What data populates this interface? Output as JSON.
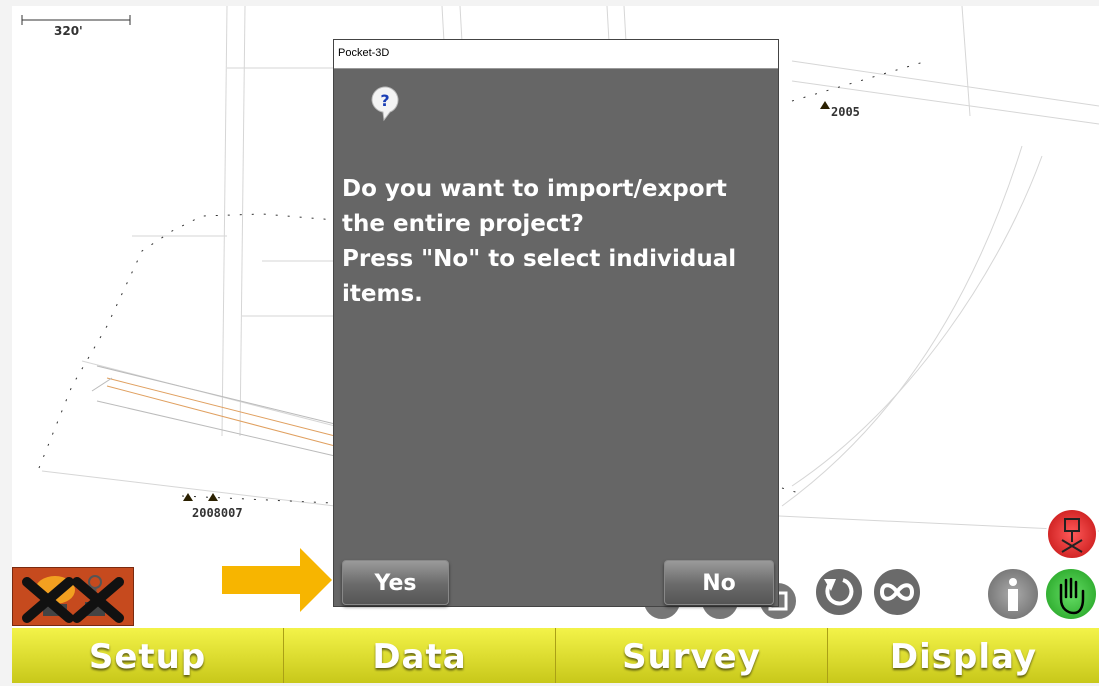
{
  "map": {
    "scale_label": "320'",
    "points": [
      {
        "label": "2005"
      },
      {
        "label": "2008007"
      }
    ]
  },
  "dialog": {
    "title": "Pocket-3D",
    "icon": "question-icon",
    "message": "Do you want to import/export the entire project?\nPress \"No\" to select individual items.",
    "yes_label": "Yes",
    "no_label": "No"
  },
  "tools": {
    "info_icon": "info-icon",
    "pan_icon": "hand-icon",
    "rotate_icon": "rotate-icon",
    "infinity_icon": "infinity-icon",
    "receiver_icon": "receiver-disconnected-icon",
    "gps_status_icon": "gps-no-fix-icon"
  },
  "tabs": [
    {
      "label": "Setup"
    },
    {
      "label": "Data"
    },
    {
      "label": "Survey"
    },
    {
      "label": "Display"
    }
  ],
  "colors": {
    "tab_yellow": "#e8e830",
    "dialog_gray": "#666666",
    "arrow_orange": "#f7b500",
    "pan_green": "#2db82d",
    "alert_red": "#d42020"
  }
}
